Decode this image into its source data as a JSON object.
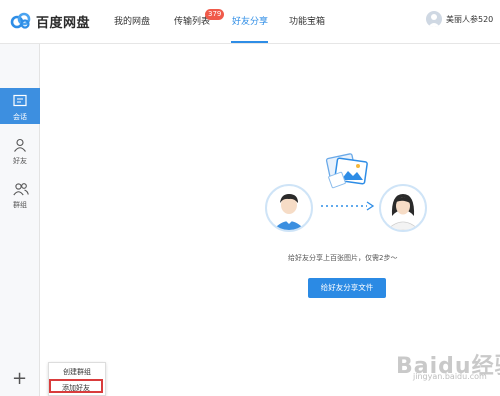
{
  "app": {
    "title": "百度网盘"
  },
  "nav": {
    "items": [
      {
        "label": "我的网盘"
      },
      {
        "label": "传输列表",
        "badge": "379"
      },
      {
        "label": "好友分享",
        "active": true
      },
      {
        "label": "功能宝箱"
      }
    ]
  },
  "user": {
    "name": "美丽人参520"
  },
  "sidebar": {
    "items": [
      {
        "label": "会话",
        "icon": "chat-icon",
        "active": true
      },
      {
        "label": "好友",
        "icon": "person-icon"
      },
      {
        "label": "群组",
        "icon": "group-icon"
      }
    ],
    "add": "+"
  },
  "popup": {
    "items": [
      {
        "label": "创建群组"
      },
      {
        "label": "添加好友",
        "highlighted": true
      }
    ]
  },
  "main": {
    "description": "给好友分享上百张图片，仅需2步～",
    "share_button": "给好友分享文件"
  },
  "watermark": {
    "text": "Baidu经验",
    "sub": "jingyan.baidu.com"
  },
  "colors": {
    "accent": "#2e8de6",
    "badge": "#f05a4a",
    "highlight": "#d93c3c"
  }
}
